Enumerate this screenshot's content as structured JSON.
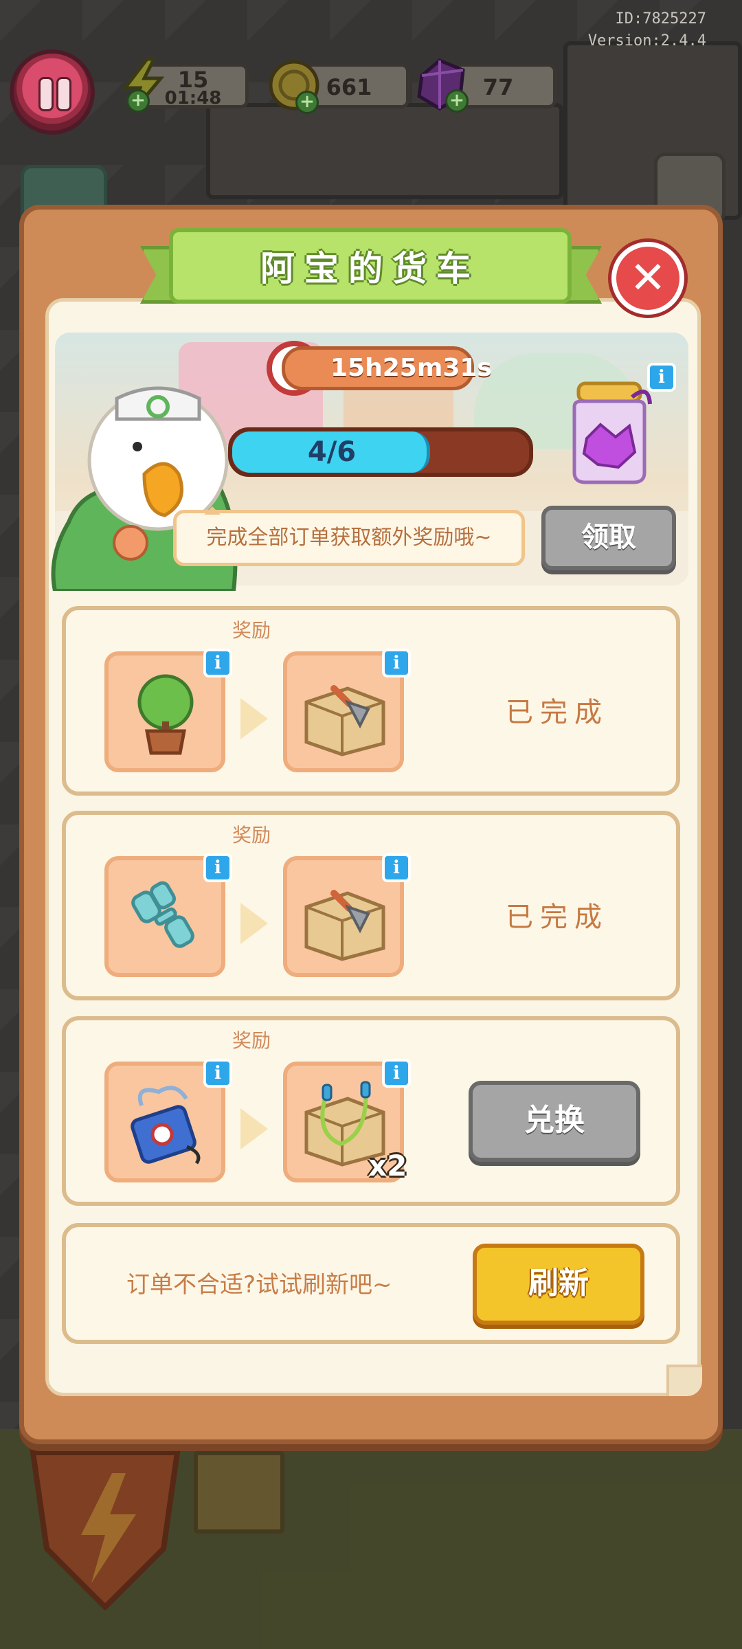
{
  "hud": {
    "id_text": "ID:7825227",
    "version_text": "Version:2.4.4",
    "energy": {
      "value": "15",
      "timer": "01:48"
    },
    "coins": {
      "value": "661"
    },
    "gems": {
      "value": "77"
    }
  },
  "modal": {
    "title": "阿宝的货车",
    "close_icon": "close-icon",
    "banner": {
      "countdown": "15h25m31s",
      "progress_text": "4/6",
      "progress_fraction": 0.667,
      "message": "完成全部订单获取额外奖励哦~",
      "claim_label": "领取"
    },
    "orders": [
      {
        "reward_label": "奖励",
        "input_item": "potted-plant-icon",
        "reward_item": "tool-box-trowel-icon",
        "status": "已完成"
      },
      {
        "reward_label": "奖励",
        "input_item": "dumbbell-icon",
        "reward_item": "tool-box-trowel-icon",
        "status": "已完成"
      },
      {
        "reward_label": "奖励",
        "input_item": "cd-player-icon",
        "reward_item": "tool-box-jump-rope-icon",
        "reward_qty": "x2",
        "action_label": "兑换"
      }
    ],
    "refresh": {
      "prompt": "订单不合适?试试刷新吧~",
      "button_label": "刷新"
    }
  },
  "colors": {
    "title_ribbon": "#b7e36a",
    "panel_frame": "#cf8b57",
    "refresh_button": "#f4c52a",
    "disabled_button": "#a5a5a5",
    "progress_fill": "#3fd3f2"
  }
}
